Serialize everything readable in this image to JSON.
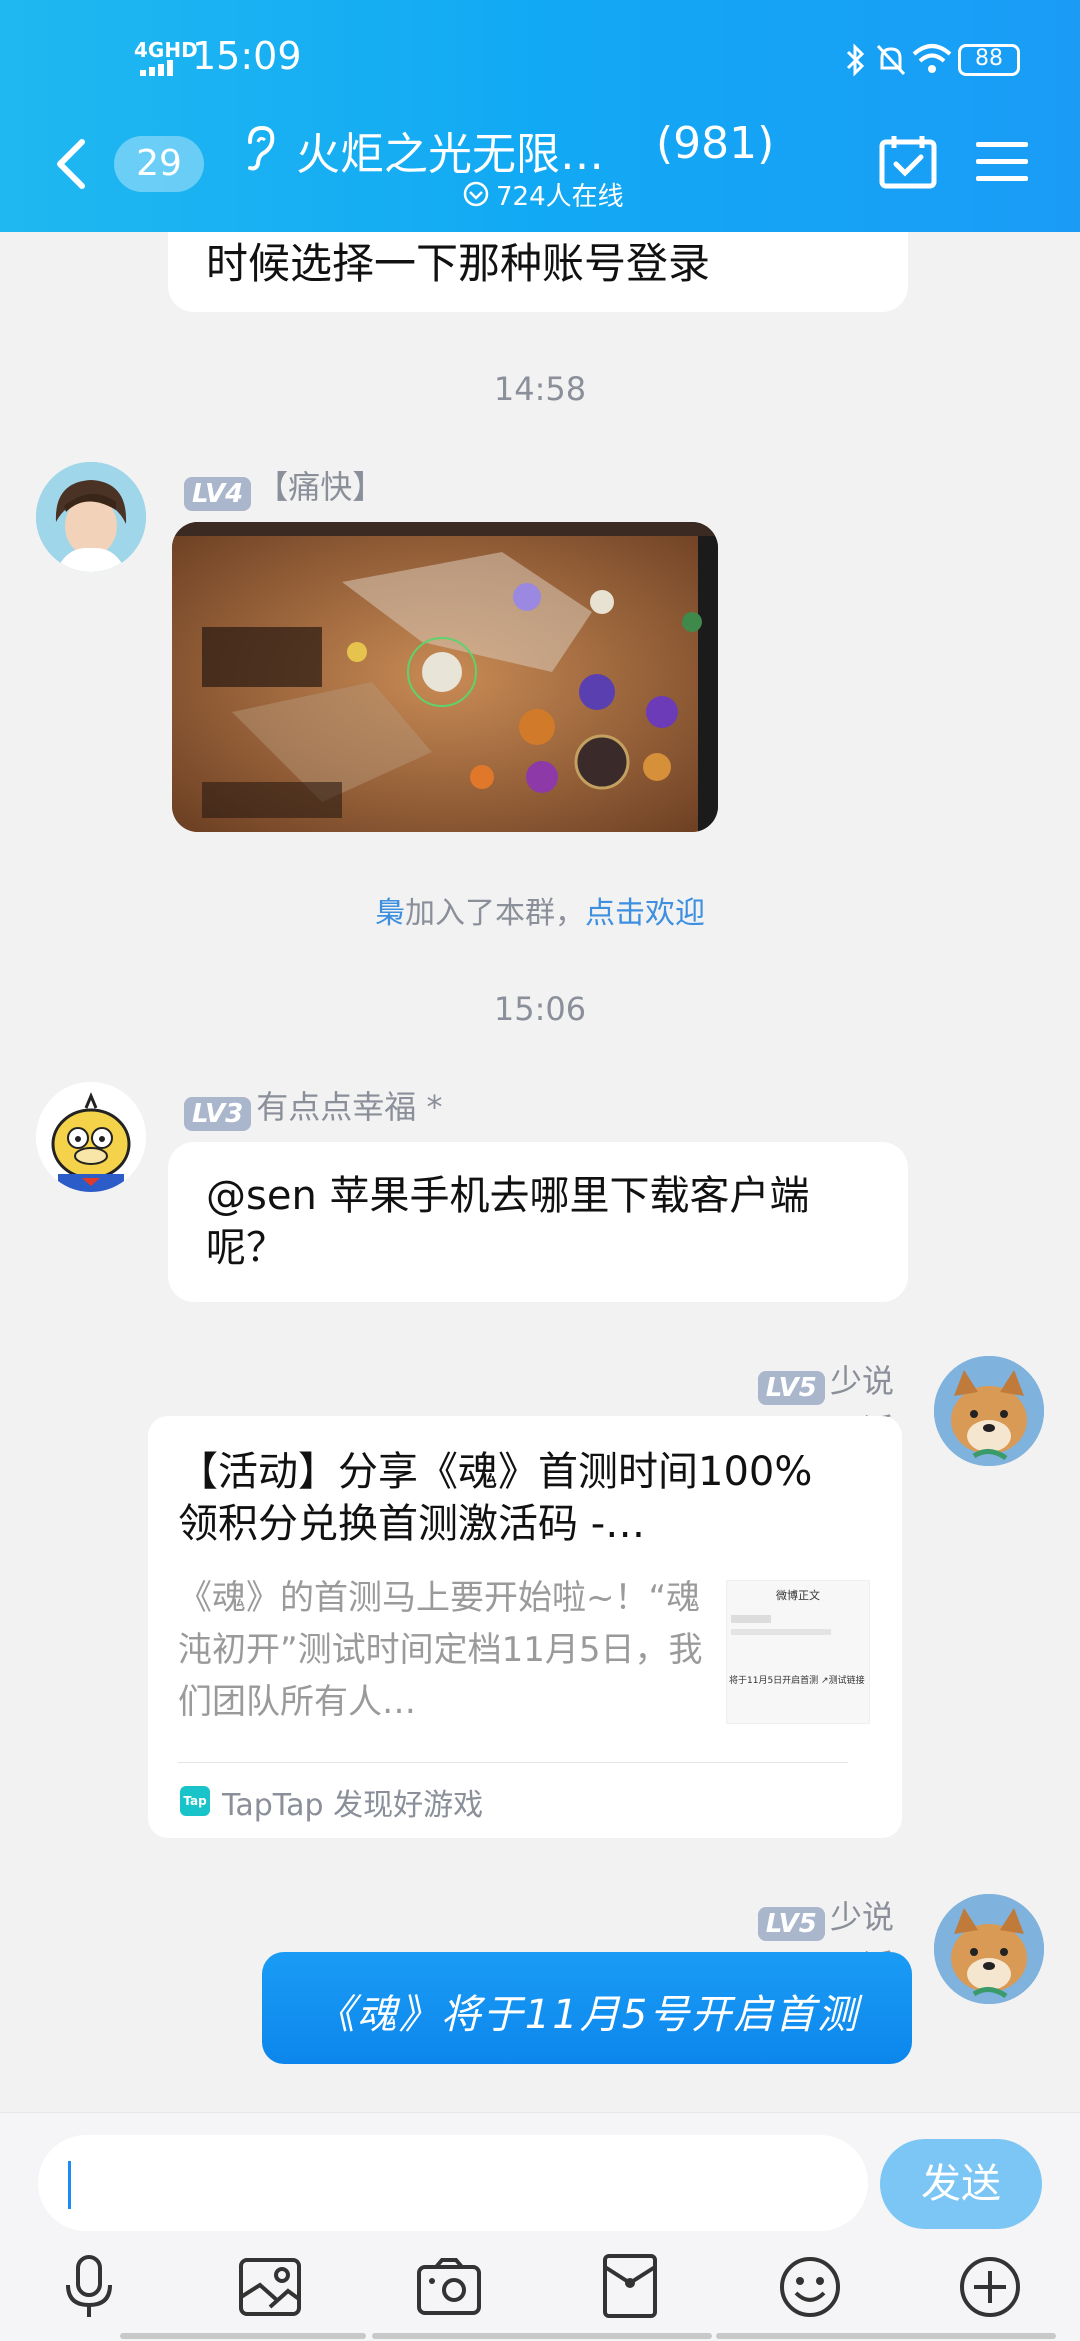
{
  "status": {
    "network": "4GHD",
    "time": "15:09",
    "battery": "88"
  },
  "header": {
    "back_count": "29",
    "group_name": "火炬之光无限…",
    "member_count": "(981)",
    "online": "724人在线"
  },
  "messages": {
    "prev_text": "时候选择一下那种账号登录",
    "time1": "14:58",
    "msg1": {
      "level": "LV4",
      "name": "【痛快】"
    },
    "join": {
      "name": "梟",
      "text": "加入了本群，",
      "link": "点击欢迎"
    },
    "time2": "15:06",
    "msg2": {
      "level": "LV3",
      "name": "有点点幸福 *",
      "text": "@sen 苹果手机去哪里下载客户端呢？"
    },
    "msg3": {
      "level": "LV5",
      "name": "少说话",
      "card_title": "【活动】分享《魂》首测时间100%领积分兑换首测激活码 -…",
      "card_desc": "《魂》的首测马上要开始啦~！“魂沌初开”测试时间定档11月5日，我们团队所有人…",
      "source_logo": "Tap",
      "source": "TapTap 发现好游戏",
      "thumb_title": "微博正文",
      "thumb_line": "将于11月5日开启首测 ↗测试链接"
    },
    "msg4": {
      "level": "LV5",
      "name": "少说话",
      "text": "《魂》将于11月5号开启首测"
    }
  },
  "input": {
    "send_label": "发送"
  }
}
